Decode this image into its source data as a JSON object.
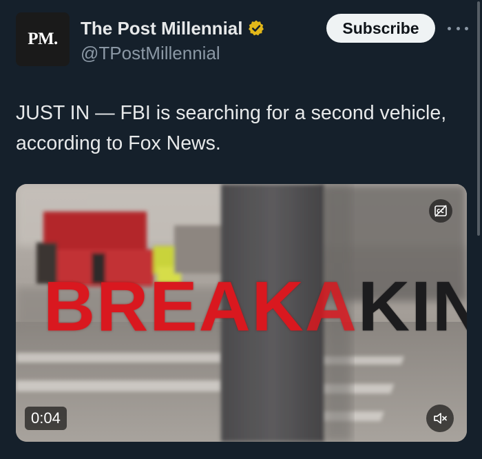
{
  "author": {
    "avatar_text": "PM.",
    "name": "The Post Millennial",
    "handle": "@TPostMillennial",
    "verified_color": "#e2b719"
  },
  "actions": {
    "subscribe_label": "Subscribe",
    "more_icon": "more-horizontal-icon"
  },
  "tweet": {
    "text": "JUST IN — FBI is searching for a second vehicle, according to Fox News."
  },
  "media": {
    "type": "video",
    "overlay_text_red": "BREAK",
    "overlay_text_mid": "A",
    "overlay_text_dark": "KING",
    "duration": "0:04",
    "captions_icon": "closed-captions-icon",
    "mute_icon": "volume-muted-icon"
  },
  "colors": {
    "background": "#15202b",
    "text_primary": "#e7e9ea",
    "text_secondary": "#8b98a5",
    "breaking_red": "#d9181f"
  }
}
